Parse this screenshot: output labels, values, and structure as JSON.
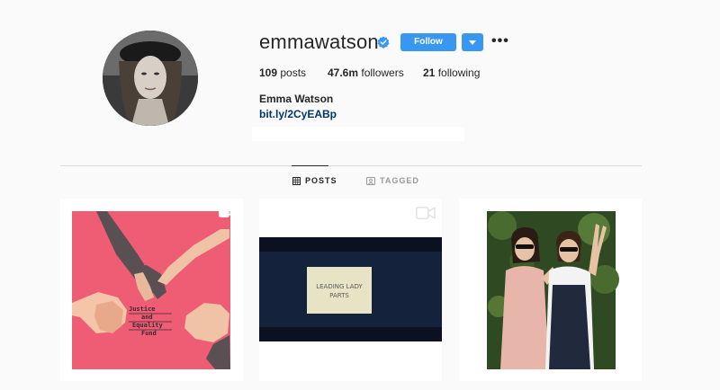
{
  "profile": {
    "username": "emmawatson",
    "follow_label": "Follow",
    "more_label": "•••",
    "full_name": "Emma Watson",
    "link": "bit.ly/2CyEABp"
  },
  "stats": {
    "posts_count": "109",
    "posts_label": "posts",
    "followers_count": "47.6m",
    "followers_label": "followers",
    "following_count": "21",
    "following_label": "following"
  },
  "tabs": [
    {
      "label": "POSTS",
      "icon": "grid-icon",
      "active": true
    },
    {
      "label": "TAGGED",
      "icon": "tagged-icon",
      "active": false
    }
  ],
  "posts": [
    {
      "type": "carousel",
      "art_text": [
        "Justice",
        "and",
        "Equality",
        "Fund"
      ]
    },
    {
      "type": "video",
      "art_text": [
        "LEADING LADY",
        "PARTS"
      ]
    },
    {
      "type": "carousel"
    }
  ],
  "colors": {
    "accent": "#3897f0",
    "link": "#003569",
    "background": "#fafafa",
    "verified": "#3897f0",
    "poster_pink": "#ef5d75"
  }
}
